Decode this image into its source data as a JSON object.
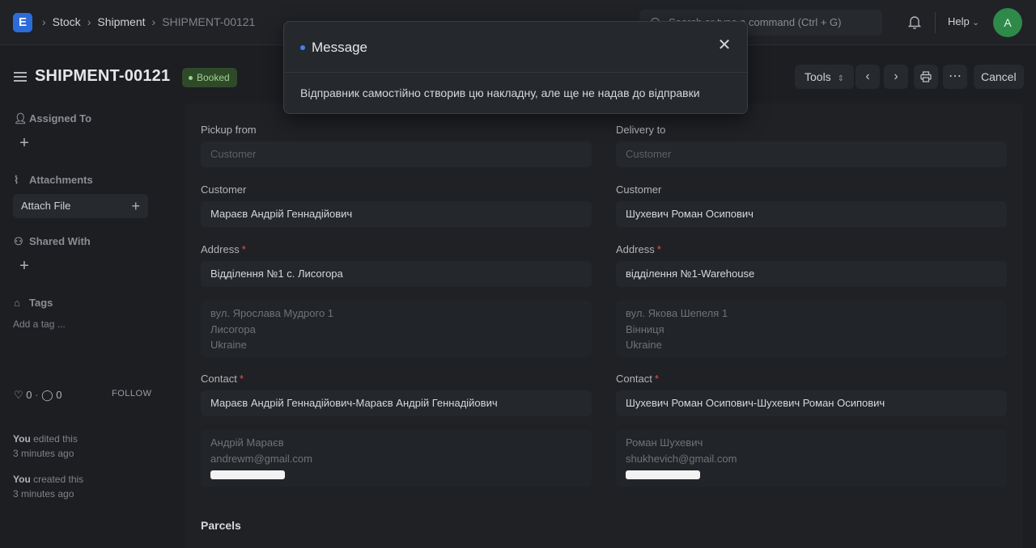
{
  "navbar": {
    "logo": "E",
    "breadcrumbs": [
      "Stock",
      "Shipment",
      "SHIPMENT-00121"
    ],
    "search_placeholder": "Search or type a command (Ctrl + G)",
    "help": "Help",
    "avatar": "A"
  },
  "page": {
    "title": "SHIPMENT-00121",
    "status": "Booked",
    "tools": "Tools",
    "cancel": "Cancel"
  },
  "sidebar": {
    "assigned_to": "Assigned To",
    "attachments": "Attachments",
    "attach_file": "Attach File",
    "shared_with": "Shared With",
    "tags": "Tags",
    "add_tag": "Add a tag ...",
    "likes": "0",
    "comments": "0",
    "follow": "FOLLOW",
    "activity": [
      {
        "who": "You",
        "what": "edited this",
        "when": "3 minutes ago"
      },
      {
        "who": "You",
        "what": "created this",
        "when": "3 minutes ago"
      }
    ]
  },
  "form": {
    "pickup": {
      "section_label": "Pickup from",
      "type_placeholder": "Customer",
      "customer_label": "Customer",
      "customer": "Мараєв Андрій Геннадійович",
      "address_label": "Address",
      "address": "Відділення №1 с. Лисогора",
      "address_lines": [
        "вул. Ярослава Мудрого 1",
        "Лисогора",
        "Ukraine"
      ],
      "contact_label": "Contact",
      "contact": "Мараєв Андрій Геннадійович-Мараєв Андрій Геннадійович",
      "contact_lines": [
        "Андрій Мараєв",
        "andrewm@gmail.com"
      ]
    },
    "delivery": {
      "section_label": "Delivery to",
      "type_placeholder": "Customer",
      "customer_label": "Customer",
      "customer": "Шухевич Роман Осипович",
      "address_label": "Address",
      "address": "відділення №1-Warehouse",
      "address_lines": [
        "вул. Якова Шепеля 1",
        "Вінниця",
        "Ukraine"
      ],
      "contact_label": "Contact",
      "contact": "Шухевич Роман Осипович-Шухевич Роман Осипович",
      "contact_lines": [
        "Роман Шухевич",
        "shukhevich@gmail.com"
      ]
    },
    "parcels": "Parcels"
  },
  "modal": {
    "title": "Message",
    "body": "Відправник самостійно створив цю накладну, але ще не надав до відправки"
  },
  "colors": {
    "accent": "#3b82f6",
    "status_badge_bg": "#2f4a2a",
    "status_badge_text": "#9fd18f",
    "required": "#e05252"
  }
}
